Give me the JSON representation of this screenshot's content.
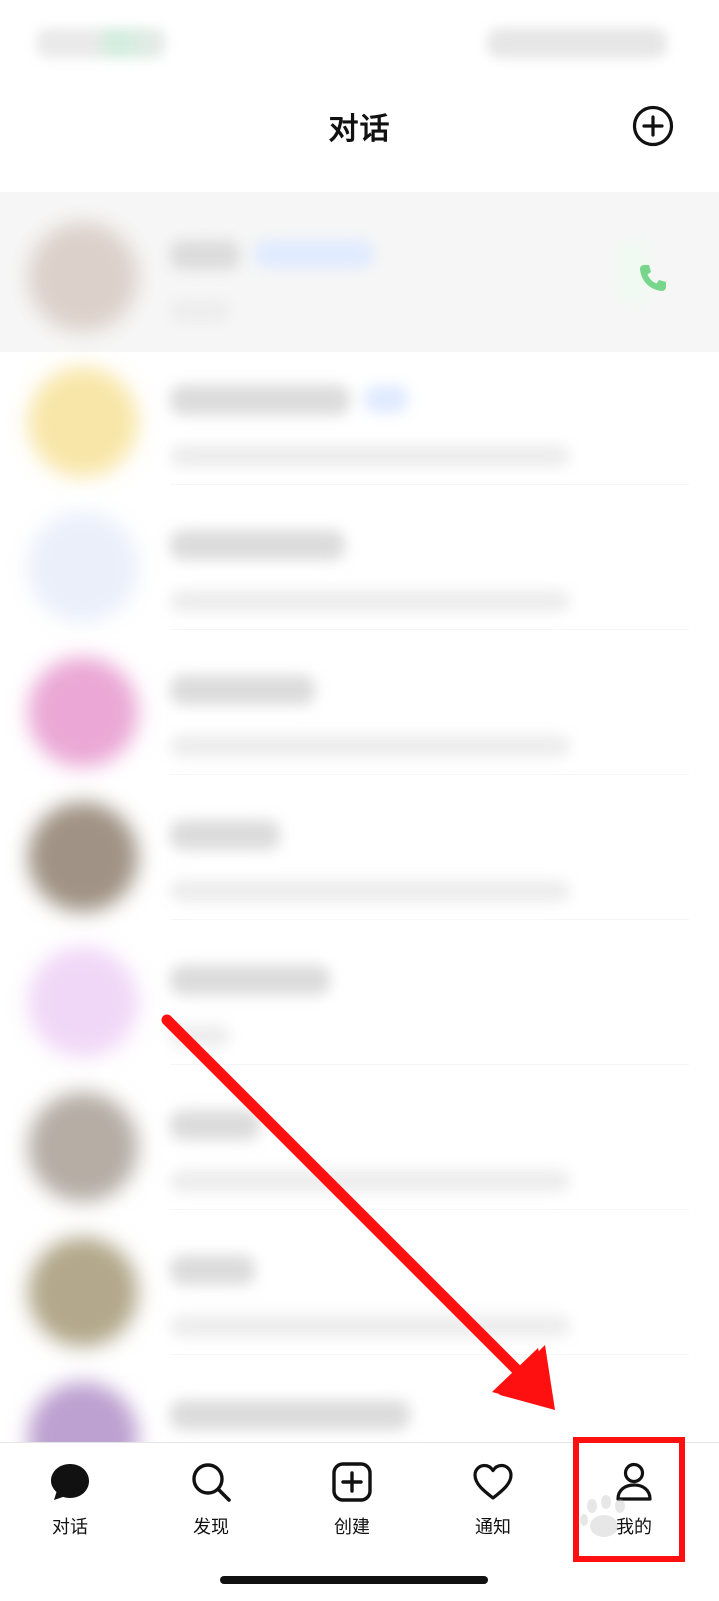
{
  "header": {
    "title": "对话",
    "add_icon": "plus-circle-icon"
  },
  "conversations": [
    {
      "pinned": true,
      "avatar_color": "#c9b8ae",
      "has_tag": true,
      "has_call": true
    },
    {
      "pinned": false,
      "avatar_color": "#f5d97a",
      "has_tag": true,
      "has_call": false
    },
    {
      "pinned": false,
      "avatar_color": "#dfe7f8",
      "has_tag": false,
      "has_call": false
    },
    {
      "pinned": false,
      "avatar_color": "#e07ac0",
      "has_tag": false,
      "has_call": false
    },
    {
      "pinned": false,
      "avatar_color": "#6e5a44",
      "has_tag": false,
      "has_call": false
    },
    {
      "pinned": false,
      "avatar_color": "#e9c2f3",
      "has_tag": false,
      "has_call": false
    },
    {
      "pinned": false,
      "avatar_color": "#8f8276",
      "has_tag": false,
      "has_call": false
    },
    {
      "pinned": false,
      "avatar_color": "#8a7a4e",
      "has_tag": false,
      "has_call": false
    },
    {
      "pinned": false,
      "avatar_color": "#9a6fb8",
      "has_tag": false,
      "has_call": false
    }
  ],
  "nav": {
    "items": [
      {
        "label": "对话",
        "icon": "chat-bubble-icon",
        "active": true
      },
      {
        "label": "发现",
        "icon": "search-icon",
        "active": false
      },
      {
        "label": "创建",
        "icon": "plus-square-icon",
        "active": false
      },
      {
        "label": "通知",
        "icon": "heart-icon",
        "active": false
      },
      {
        "label": "我的",
        "icon": "person-icon",
        "active": false
      }
    ]
  },
  "colors": {
    "accent_annotation": "#ff1010",
    "call_green": "#2fbf4f",
    "pinned_bg": "#f2f2f2"
  }
}
